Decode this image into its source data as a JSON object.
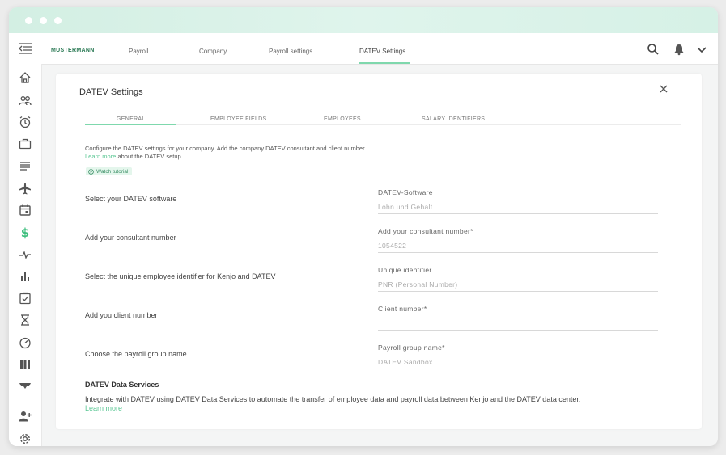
{
  "colors": {
    "accent": "#7fd8ad",
    "link": "#5bc794",
    "brand": "#2b7a55",
    "titlebar": "#d6f1e6"
  },
  "topnav": {
    "brand": "MUSTERMANN",
    "tabs": [
      {
        "label": "Payroll"
      },
      {
        "label": "Company"
      },
      {
        "label": "Payroll settings"
      },
      {
        "label": "DATEV Settings",
        "active": true
      }
    ],
    "tools": [
      "search-icon",
      "bell-icon",
      "chevron-down-icon"
    ]
  },
  "sidebar": {
    "icons": [
      "home-icon",
      "people-icon",
      "alarm-clock-icon",
      "briefcase-icon",
      "list-icon",
      "airplane-icon",
      "calendar-icon",
      "dollar-icon",
      "pulse-icon",
      "bar-chart-icon",
      "checklist-icon",
      "hourglass-icon",
      "gauge-icon",
      "columns-icon",
      "megaphone-icon",
      "add-user-icon",
      "gear-icon"
    ],
    "active": "dollar-icon"
  },
  "card": {
    "title": "DATEV Settings",
    "subtabs": [
      {
        "label": "GENERAL",
        "active": true
      },
      {
        "label": "EMPLOYEE FIELDS"
      },
      {
        "label": "EMPLOYEES"
      },
      {
        "label": "SALARY IDENTIFIERS"
      }
    ],
    "intro": "Configure the DATEV settings for your company. Add the company DATEV consultant and client number",
    "learn_more_link": "Learn more",
    "learn_more_suffix": " about the DATEV setup",
    "tutorial_label": "Watch tutorial",
    "rows": [
      {
        "label": "Select your DATEV software",
        "field_label": "DATEV-Software",
        "value": "Lohn und Gehalt"
      },
      {
        "label": "Add your consultant number",
        "field_label": "Add your consultant number*",
        "value": "1054522"
      },
      {
        "label": "Select the unique employee identifier for Kenjo and DATEV",
        "field_label": "Unique identifier",
        "value": "PNR (Personal Number)"
      },
      {
        "label": "Add you client number",
        "field_label": "Client number*",
        "value": ""
      },
      {
        "label": "Choose the payroll group name",
        "field_label": "Payroll group name*",
        "value": "DATEV Sandbox"
      }
    ],
    "data_services": {
      "title": "DATEV Data Services",
      "text": "Integrate with DATEV using DATEV Data Services to automate the transfer of employee data and payroll data between Kenjo and the DATEV data center.",
      "link": "Learn more"
    }
  }
}
